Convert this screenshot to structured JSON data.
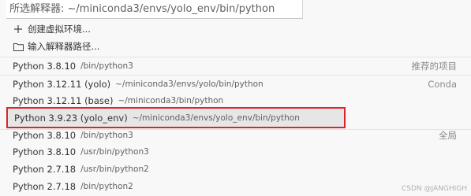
{
  "search": {
    "placeholder": "所选解释器: ~/miniconda3/envs/yolo_env/bin/python"
  },
  "actions": [
    {
      "icon": "plus-icon",
      "label": "创建虚拟环境..."
    },
    {
      "icon": "folder-icon",
      "label": "输入解释器路径..."
    }
  ],
  "groups": {
    "recommended": "推荐的项目",
    "conda": "Conda",
    "global": "全局"
  },
  "interpreters": [
    {
      "name": "Python 3.8.10",
      "path": "/bin/python3"
    },
    {
      "name": "Python 3.12.11 (yolo)",
      "path": "~/miniconda3/envs/yolo/bin/python"
    },
    {
      "name": "Python 3.12.11 (base)",
      "path": "~/miniconda3/bin/python"
    },
    {
      "name": "Python 3.9.23 (yolo_env)",
      "path": "~/miniconda3/envs/yolo_env/bin/python"
    },
    {
      "name": "Python 3.8.10",
      "path": "/bin/python3"
    },
    {
      "name": "Python 3.8.10",
      "path": "/usr/bin/python3"
    },
    {
      "name": "Python 2.7.18",
      "path": "/usr/bin/python2"
    },
    {
      "name": "Python 2.7.18",
      "path": "/bin/python2"
    }
  ],
  "watermark": "CSDN @JANGHIGH",
  "colors": {
    "highlight_border": "#d9262a",
    "selected_bg": "#e6e6e6"
  }
}
